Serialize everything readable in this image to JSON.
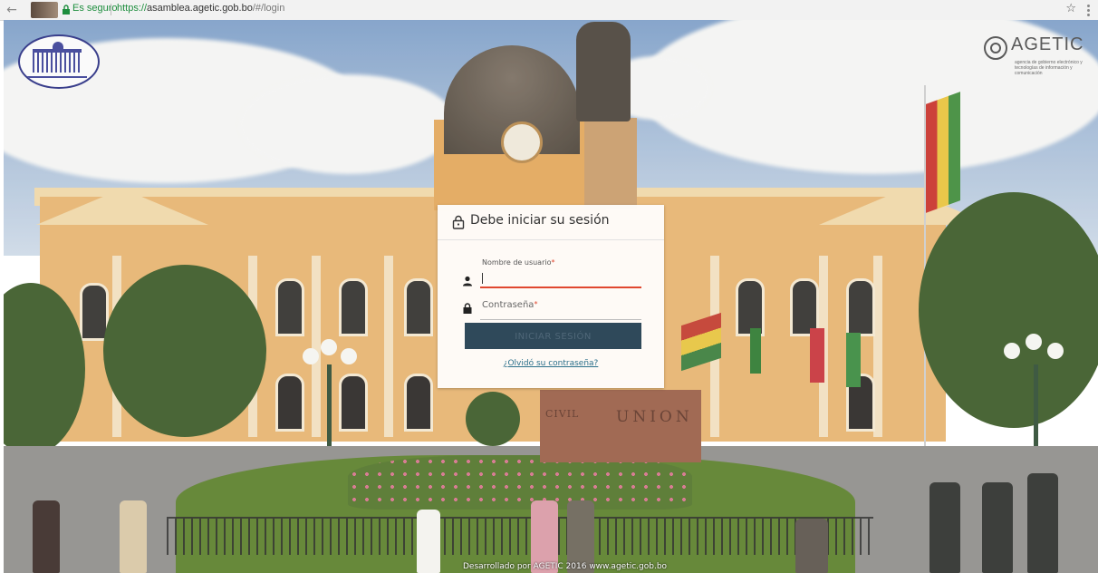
{
  "browser": {
    "secure_label": "Es seguro",
    "url_protocol": "https://",
    "url_host": "asamblea.agetic.gob.bo",
    "url_path": "/#/login"
  },
  "logos": {
    "left_logo": "ASAMBLEA LEGISLATIVA PLURINACIONAL",
    "agetic_name": "AGETIC",
    "agetic_tagline": "agencia de gobierno electrónico y tecnologías de información y comunicación"
  },
  "login": {
    "title": "Debe iniciar su sesión",
    "username_label": "Nombre de usuario",
    "username_value": "",
    "password_label": "Contraseña",
    "password_value": "",
    "required_mark": "*",
    "submit_label": "INICIAR SESIÓN",
    "forgot_link": "¿Olvidó su contraseña?"
  },
  "scene": {
    "monument_text": "UNION",
    "monument_text_left": "CIVIL"
  },
  "footer": {
    "credit": "Desarrollado por AGETIC 2016 www.agetic.gob.bo"
  },
  "colors": {
    "accent_error": "#e0472f",
    "button_bg": "#2f495a",
    "link": "#2b6f8a",
    "secure_green": "#1e8e3e"
  }
}
